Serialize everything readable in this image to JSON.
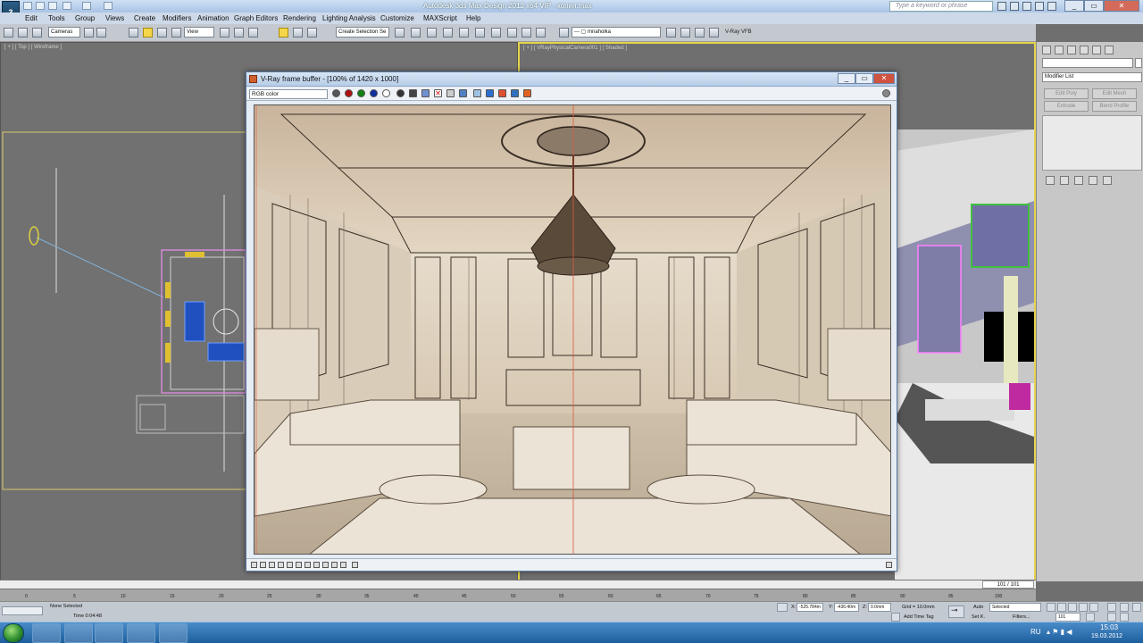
{
  "app": {
    "title": "Autodesk 3ds Max Design 2012 x64    VIP - копия.max",
    "logo_text": "3",
    "search_placeholder": "Type a keyword or phrase"
  },
  "menu": [
    "Edit",
    "Tools",
    "Group",
    "Views",
    "Create",
    "Modifiers",
    "Animation",
    "Graph Editors",
    "Rendering",
    "Lighting Analysis",
    "Customize",
    "MAXScript",
    "Help"
  ],
  "toolbar": {
    "filter": "Cameras",
    "coord": "View",
    "selection_set": "Create Selection Se",
    "layer": "--- ▢ mnaholka",
    "vfb_label": "V-Ray VFB"
  },
  "viewports": {
    "top_label": "[ + ] [ Top ] [ Wireframe ]",
    "persp_label": "[ + ] [ VRayPhysicalCamera001 ] [ Shaded ]"
  },
  "command_panel": {
    "modifier_list": "Modifier List",
    "buttons": [
      "Edit Poly",
      "Edit Mesh",
      "Extrude",
      "Bend Profile"
    ]
  },
  "vfb": {
    "title": "V-Ray frame buffer - [100% of 1420 x 1000]",
    "channel": "RGB color"
  },
  "timeline": {
    "frame_readout": "101 / 101",
    "ticks": [
      "0",
      "5",
      "10",
      "15",
      "20",
      "25",
      "30",
      "35",
      "40",
      "45",
      "50",
      "55",
      "60",
      "65",
      "70",
      "75",
      "80",
      "85",
      "90",
      "95",
      "100"
    ]
  },
  "status": {
    "selection": "None Selected",
    "render_time": "Time  0:04:48",
    "x_value": "-525.784m",
    "y_value": "-436.40m",
    "z_value": "0.0mm",
    "grid": "Grid = 10.0mm",
    "add_time_tag": "Add Time Tag",
    "auto": "Auto",
    "set_k": "Set K.",
    "selected": "Selected",
    "filters": "Filters...",
    "frame": "101"
  },
  "taskbar": {
    "lang": "RU",
    "time": "15:03",
    "date": "19.03.2012"
  }
}
